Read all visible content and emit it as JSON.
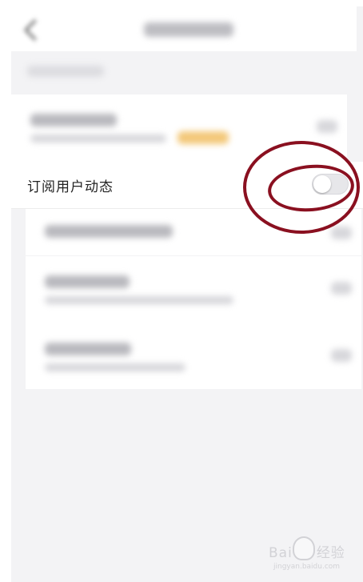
{
  "subscribe_row": {
    "label": "订阅用户动态",
    "toggle_state": "off"
  },
  "watermark": {
    "text": "Bai",
    "suffix": "经验",
    "url": "jingyan.baidu.com"
  },
  "colors": {
    "annotation": "#8a1020",
    "accent_orange": "#f3c879",
    "background": "#f3f3f5"
  }
}
